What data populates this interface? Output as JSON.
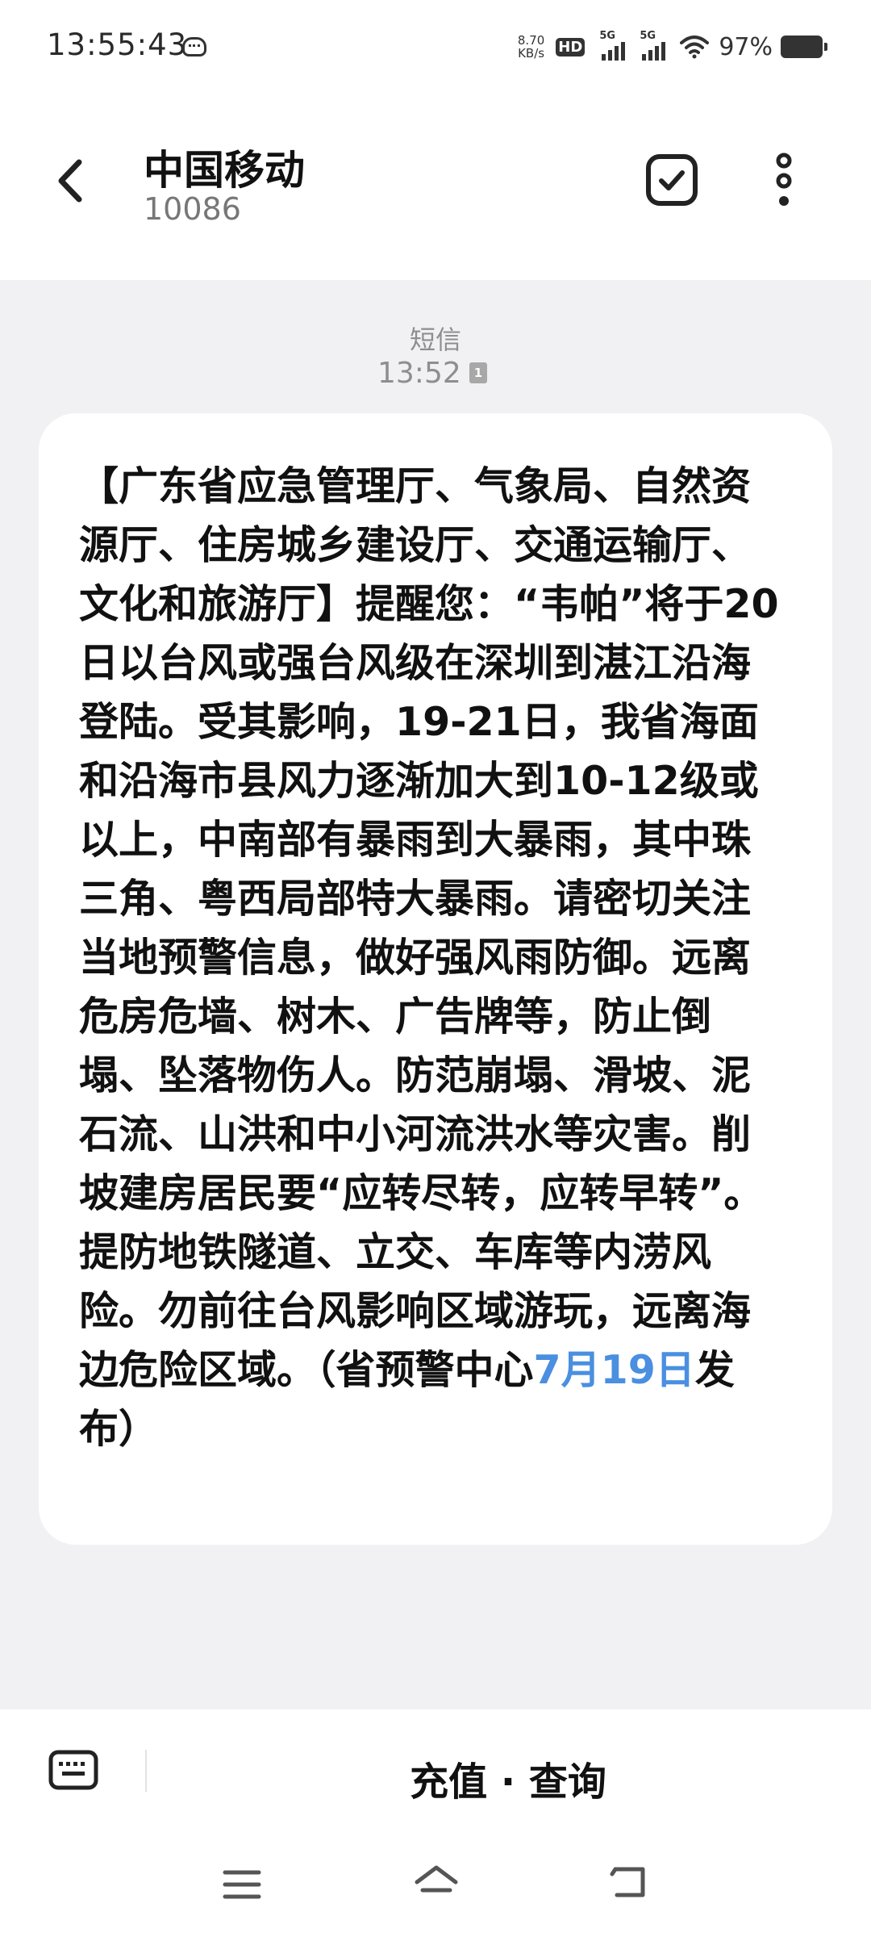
{
  "status_bar": {
    "time": "13:55:43",
    "net_speed_value": "8.70",
    "net_speed_unit": "KB/s",
    "hd_label": "HD",
    "signal_1_label": "5G",
    "signal_2_label": "5G",
    "battery_percent": "97%"
  },
  "header": {
    "contact_name": "中国移动",
    "contact_number": "10086"
  },
  "message": {
    "type_label": "短信",
    "time": "13:52",
    "sim_slot": "1",
    "body_before_link": "【广东省应急管理厅、气象局、自然资源厅、住房城乡建设厅、交通运输厅、文化和旅游厅】提醒您：“韦帕”将于20日以台风或强台风级在深圳到湛江沿海登陆。受其影响，19-21日，我省海面和沿海市县风力逐渐加大到10-12级或以上，中南部有暴雨到大暴雨，其中珠三角、粤西局部特大暴雨。请密切关注当地预警信息，做好强风雨防御。远离危房危墙、树木、广告牌等，防止倒塌、坠落物伤人。防范崩塌、滑坡、泥石流、山洪和中小河流洪水等灾害。削坡建房居民要“应转尽转，应转早转”。提防地铁隧道、立交、车库等内涝风险。勿前往台风影响区域游玩，远离海边危险区域。（省预警中心",
    "date_link": "7月19日",
    "body_after_link": "发布）"
  },
  "bottom_bar": {
    "menu_label": "充值 · 查询"
  },
  "colors": {
    "link": "#4a8fe0",
    "background": "#f1f1f3",
    "bubble": "#ffffff"
  }
}
